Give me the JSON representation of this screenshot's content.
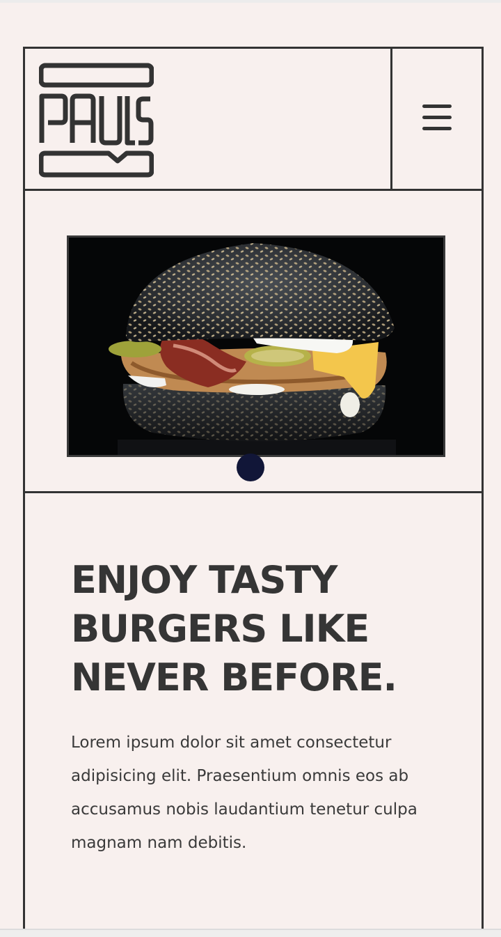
{
  "brand": {
    "logo_text": "PAULS"
  },
  "header": {
    "menu_icon": "hamburger-menu-icon"
  },
  "hero": {
    "image_alt": "Black sesame bun burger with bacon, pickles, cheese and crispy chicken",
    "carousel_dots": 1,
    "active_dot": 1
  },
  "content": {
    "headline": "ENJOY TASTY BURGERS LIKE NEVER BEFORE.",
    "body": "Lorem ipsum dolor sit amet consectetur adipisicing elit. Praesentium omnis eos ab accusamus nobis laudantium tenetur culpa magnam nam debitis."
  },
  "colors": {
    "background": "#f8f0ee",
    "lines": "#333333",
    "dot": "#111638"
  }
}
